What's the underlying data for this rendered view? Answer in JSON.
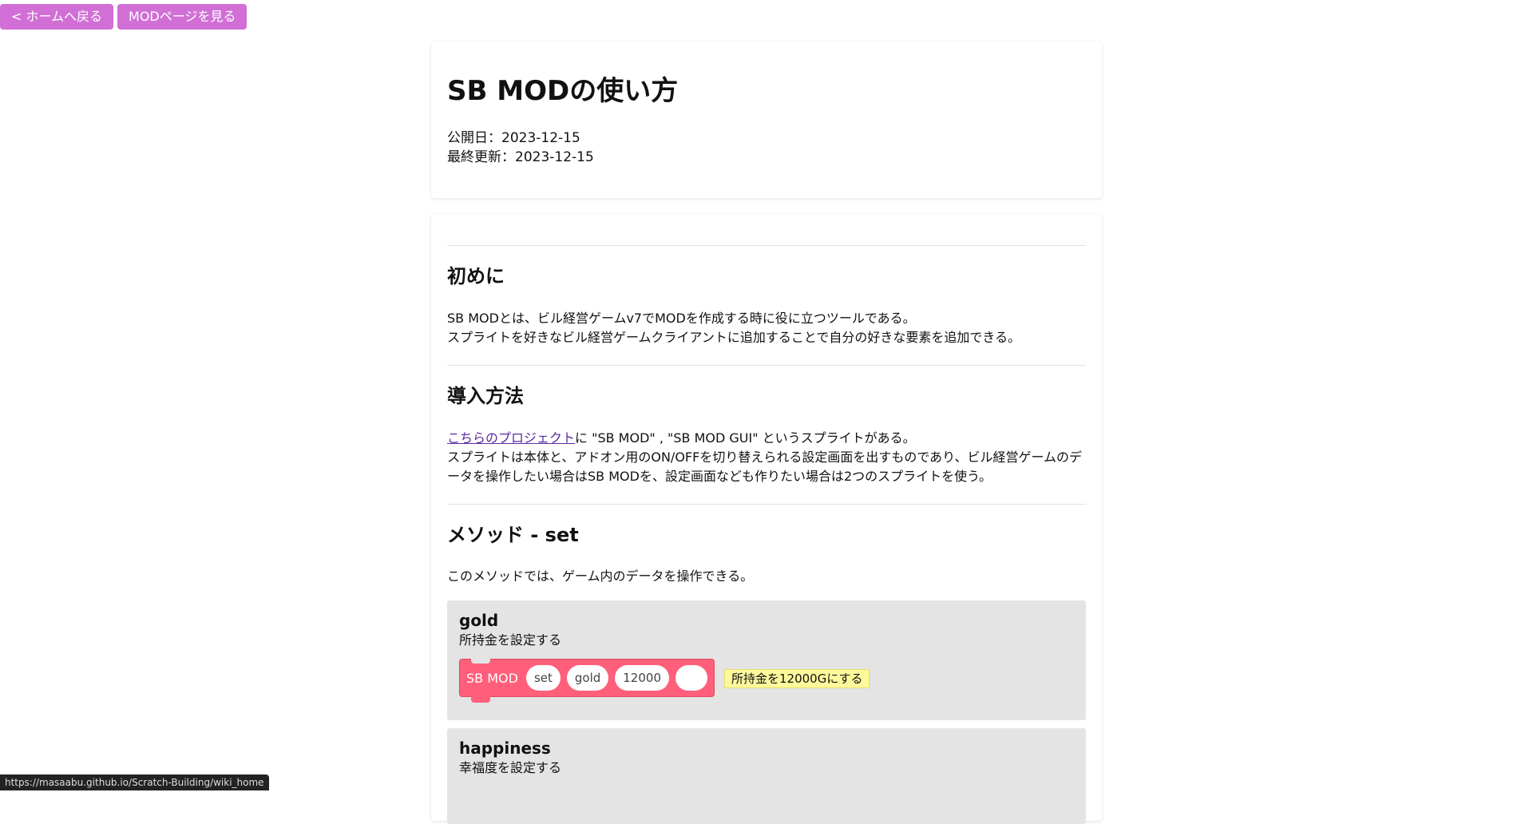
{
  "nav": {
    "home_label": "< ホームへ戻る",
    "mod_label": "MODページを見る"
  },
  "header": {
    "title": "SB MODの使い方",
    "published": "公開日：2023-12-15",
    "updated": "最終更新：2023-12-15"
  },
  "sections": {
    "intro": {
      "heading": "初めに",
      "line1": "SB MODとは、ビル経営ゲームv7でMODを作成する時に役に立つツールである。",
      "line2": "スプライトを好きなビル経営ゲームクライアントに追加することで自分の好きな要素を追加できる。"
    },
    "install": {
      "heading": "導入方法",
      "link_text": "こちらのプロジェクト",
      "line1_rest": "に \"SB MOD\" , \"SB MOD GUI\" というスプライトがある。",
      "line2": "スプライトは本体と、アドオン用のON/OFFを切り替えられる設定画面を出すものであり、ビル経営ゲームのデータを操作したい場合はSB MODを、設定画面なども作りたい場合は2つのスプライトを使う。"
    },
    "method_set": {
      "heading": "メソッド - set",
      "description": "このメソッドでは、ゲーム内のデータを操作できる。",
      "gold": {
        "title": "gold",
        "description": "所持金を設定する",
        "block_label": "SB MOD",
        "arg1": "set",
        "arg2": "gold",
        "arg3": "12000",
        "arg4": "",
        "comment": "所持金を12000Gにする"
      },
      "happiness": {
        "title": "happiness",
        "description": "幸福度を設定する"
      }
    }
  },
  "status_url": "https://masaabu.github.io/Scratch-Building/wiki_home"
}
